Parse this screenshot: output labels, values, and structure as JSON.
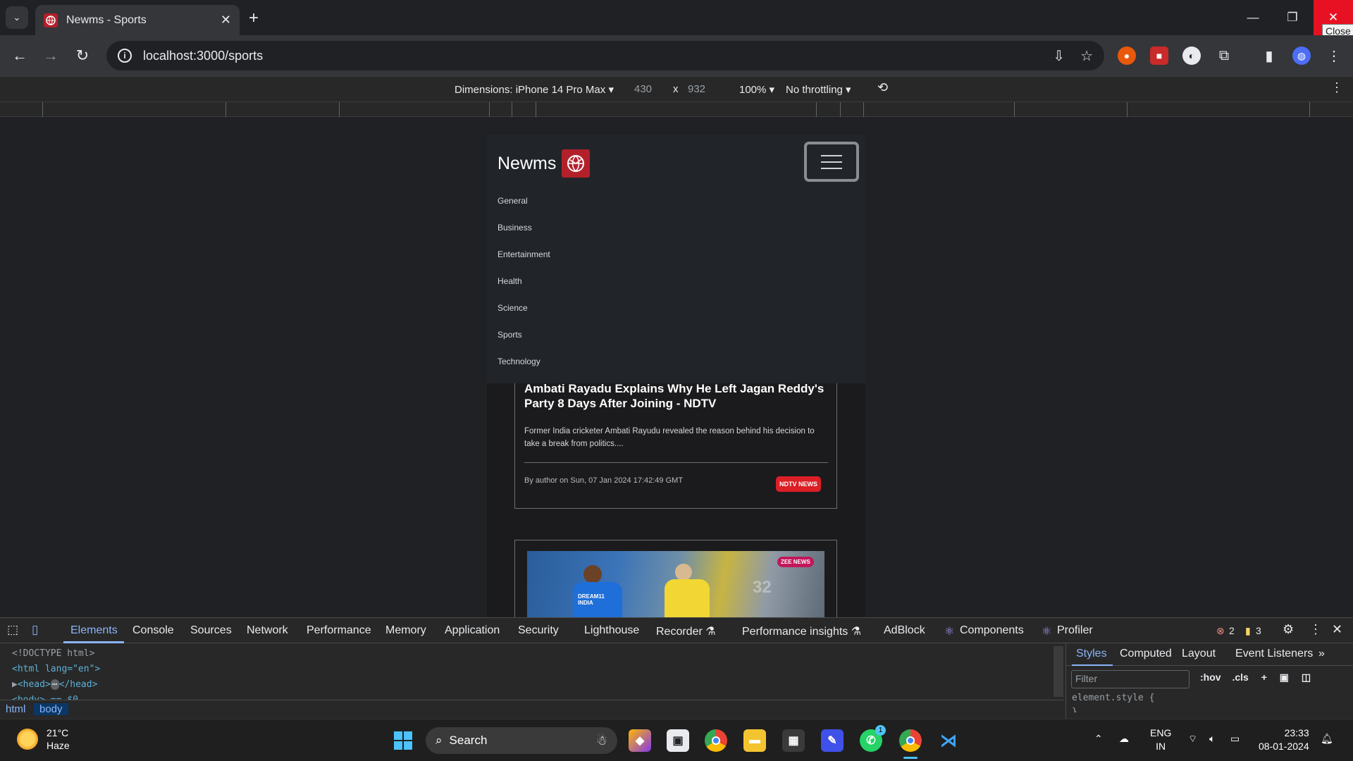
{
  "browser": {
    "tab_title": "Newms - Sports",
    "tab_close": "✕",
    "new_tab": "+",
    "url": "localhost:3000/sports",
    "close_tooltip": "Close"
  },
  "device_toolbar": {
    "dimensions_label": "Dimensions: iPhone 14 Pro Max ▾",
    "width": "430",
    "times": "x",
    "height": "932",
    "zoom": "100% ▾",
    "throttling": "No throttling ▾"
  },
  "site": {
    "brand": "Newms",
    "nav_items": [
      "General",
      "Business",
      "Entertainment",
      "Health",
      "Science",
      "Sports",
      "Technology"
    ],
    "articles": [
      {
        "title": "Ambati Rayadu Explains Why He Left Jagan Reddy's Party 8 Days After Joining - NDTV",
        "description": "Former India cricketer Ambati Rayudu revealed the reason behind his decision to take a break from politics....",
        "meta": "By author on Sun, 07 Jan 2024 17:42:49 GMT",
        "source": "NDTV NEWS"
      }
    ],
    "second_image_watermark": "ZEE NEWS",
    "second_image_jersey": "DREAM11 INDIA",
    "second_image_score": "32"
  },
  "devtools": {
    "tabs": [
      "Elements",
      "Console",
      "Sources",
      "Network",
      "Performance",
      "Memory",
      "Application",
      "Security",
      "Lighthouse",
      "Recorder ⚗",
      "Performance insights ⚗",
      "AdBlock",
      "Components",
      "Profiler"
    ],
    "errors": "2",
    "warnings": "3",
    "code_lines": {
      "doctype": "<!DOCTYPE html>",
      "html_open": "<html lang=\"en\">",
      "head": "<head>",
      "head_ellipsis": "⋯",
      "head_close": "</head>",
      "body_partial": "<body> == $0"
    },
    "breadcrumbs": [
      "html",
      "body"
    ],
    "styles_tabs": [
      "Styles",
      "Computed",
      "Layout",
      "Event Listeners",
      "»"
    ],
    "filter_placeholder": "Filter",
    "hov": ":hov",
    "cls": ".cls",
    "element_style": "element.style {",
    "element_style_close": "}"
  },
  "taskbar": {
    "temperature": "21°C",
    "condition": "Haze",
    "search": "Search",
    "language": "ENG",
    "region": "IN",
    "time": "23:33",
    "date": "08-01-2024",
    "whatsapp_badge": "1"
  }
}
